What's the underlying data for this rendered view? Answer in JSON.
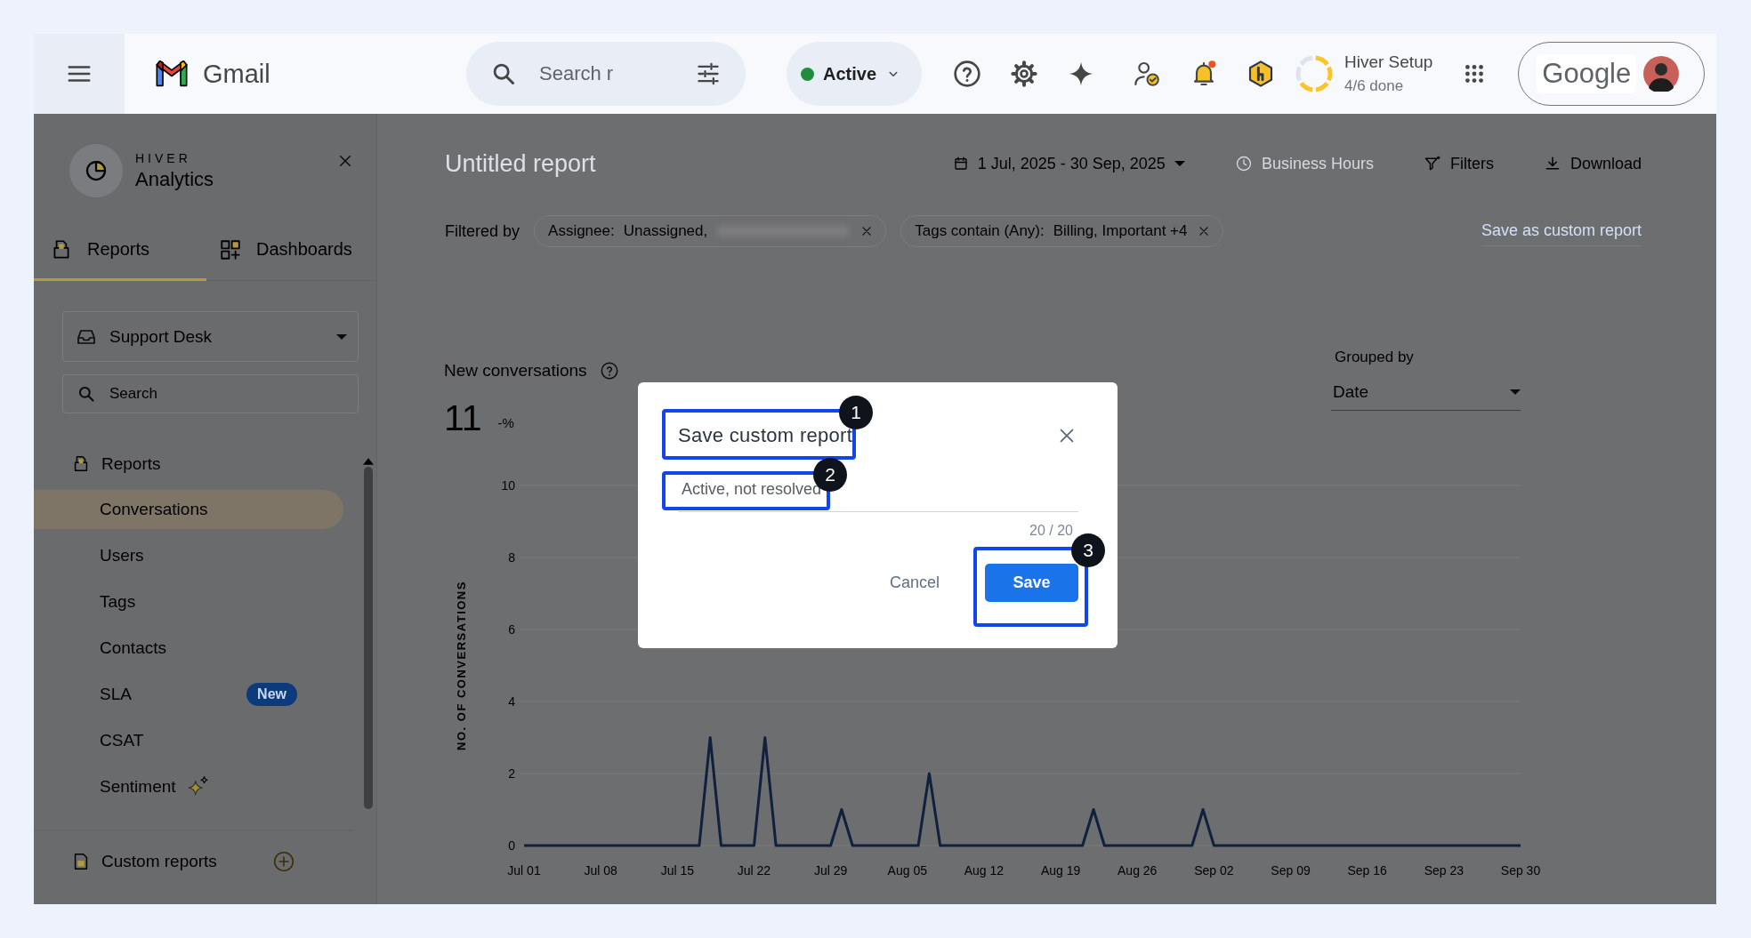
{
  "top_bar": {
    "product": "Gmail",
    "search": {
      "placeholder": "Search r"
    },
    "status": {
      "label": "Active"
    },
    "notifications": {
      "unread": true
    },
    "setup": {
      "title": "Hiver Setup",
      "progress": "4/6 done",
      "level": 0.667
    },
    "account": {
      "brand": "Google"
    }
  },
  "sidebar": {
    "brand_small": "HIVER",
    "brand": "Analytics",
    "tabs": [
      {
        "label": "Reports",
        "selected": true
      },
      {
        "label": "Dashboards",
        "selected": false
      }
    ],
    "inbox": "Support Desk",
    "search": {
      "placeholder": "Search"
    },
    "reports_heading": "Reports",
    "items": [
      {
        "label": "Conversations",
        "kind": "plain",
        "selected": true
      },
      {
        "label": "Users",
        "kind": "plain",
        "selected": false
      },
      {
        "label": "Tags",
        "kind": "plain",
        "selected": false
      },
      {
        "label": "Contacts",
        "kind": "plain",
        "selected": false
      },
      {
        "label": "SLA",
        "kind": "badge",
        "badge": "New",
        "selected": false
      },
      {
        "label": "CSAT",
        "kind": "plain",
        "selected": false
      },
      {
        "label": "Sentiment",
        "kind": "sparkle",
        "selected": false
      }
    ],
    "custom_reports": "Custom reports"
  },
  "report": {
    "title": "Untitled report",
    "date_range": "1 Jul, 2025 - 30 Sep, 2025",
    "business_hours": {
      "label": "Business Hours",
      "disabled": true
    },
    "filters_button": "Filters",
    "download_button": "Download",
    "filtered_by": "Filtered by",
    "filter_chips": [
      {
        "field": "Assignee:",
        "value": "Unassigned,",
        "redacted": true
      },
      {
        "field": "Tags contain (Any):",
        "value": "Billing, Important +4",
        "redacted": false
      }
    ],
    "save_link": "Save as custom report"
  },
  "metric": {
    "title": "New conversations",
    "value": "11",
    "change": "-%",
    "grouped_by": {
      "label": "Grouped by",
      "value": "Date"
    },
    "chart_data": {
      "type": "line",
      "grid": true,
      "ylabel": "NO. OF CONVERSATIONS",
      "ylim": [
        0,
        10
      ],
      "yticks": [
        0,
        2,
        4,
        6,
        8,
        10
      ],
      "categories": [
        "Jul 01",
        null,
        null,
        null,
        null,
        null,
        null,
        "Jul 08",
        null,
        null,
        null,
        null,
        null,
        null,
        "Jul 15",
        null,
        null,
        null,
        null,
        null,
        null,
        "Jul 22",
        null,
        null,
        null,
        null,
        null,
        null,
        "Jul 29",
        null,
        null,
        null,
        null,
        null,
        null,
        "Aug 05",
        null,
        null,
        null,
        null,
        null,
        null,
        "Aug 12",
        null,
        null,
        null,
        null,
        null,
        null,
        "Aug 19",
        null,
        null,
        null,
        null,
        null,
        null,
        "Aug 26",
        null,
        null,
        null,
        null,
        null,
        null,
        "Sep 02",
        null,
        null,
        null,
        null,
        null,
        null,
        "Sep 09",
        null,
        null,
        null,
        null,
        null,
        null,
        "Sep 16",
        null,
        null,
        null,
        null,
        null,
        null,
        "Sep 23",
        null,
        null,
        null,
        null,
        null,
        null,
        "Sep 30"
      ],
      "series": [
        {
          "color": "#10203d",
          "values": [
            0,
            0,
            0,
            0,
            0,
            0,
            0,
            0,
            0,
            0,
            0,
            0,
            0,
            0,
            0,
            0,
            0,
            3,
            0,
            0,
            0,
            0,
            3,
            0,
            0,
            0,
            0,
            0,
            0,
            1,
            0,
            0,
            0,
            0,
            0,
            0,
            0,
            2,
            0,
            0,
            0,
            0,
            0,
            0,
            0,
            0,
            0,
            0,
            0,
            0,
            0,
            0,
            1,
            0,
            0,
            0,
            0,
            0,
            0,
            0,
            0,
            0,
            1,
            0,
            0,
            0,
            0,
            0,
            0,
            0,
            0,
            0,
            0,
            0,
            0,
            0,
            0,
            0,
            0,
            0,
            0,
            0,
            0,
            0,
            0,
            0,
            0,
            0,
            0,
            0,
            0,
            0
          ]
        }
      ]
    }
  },
  "dialog": {
    "title": {
      "text": "Save custom report",
      "callout": "1"
    },
    "name_field": {
      "value": "Active, not resolved",
      "callout": "2"
    },
    "counter": "20 / 20",
    "buttons": [
      {
        "label": "Cancel",
        "kind": "text"
      },
      {
        "label": "Save",
        "kind": "primary",
        "callout": "3"
      }
    ]
  }
}
